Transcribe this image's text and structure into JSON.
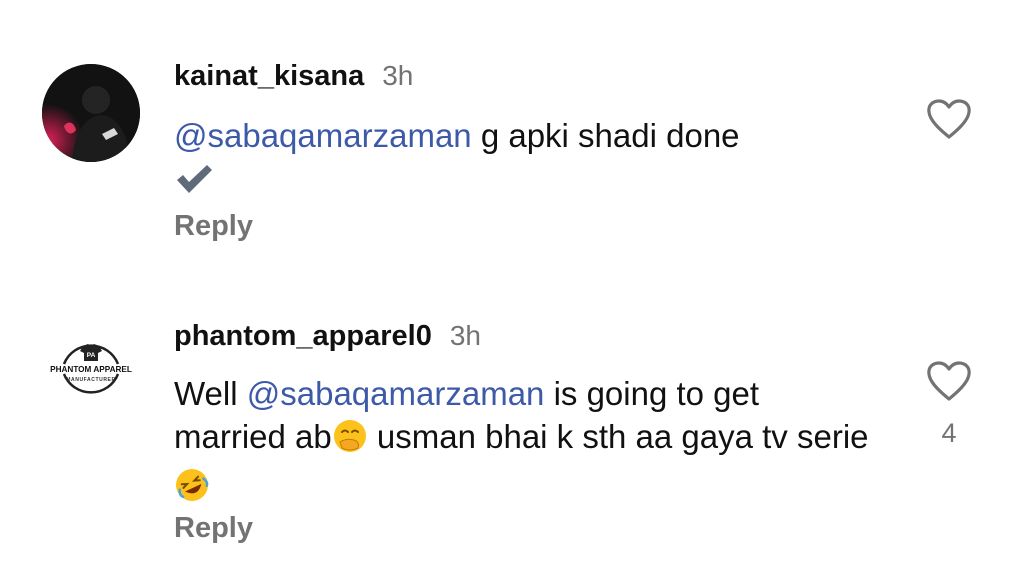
{
  "comments": [
    {
      "username": "kainat_kisana",
      "time": "3h",
      "mention": "@sabaqamarzaman",
      "text": " g apki shadi done",
      "check_icon": "heavy-check-mark-icon",
      "reply_label": "Reply",
      "likes": ""
    },
    {
      "username": "phantom_apparel0",
      "time": "3h",
      "text_prefix": "Well ",
      "mention": "@sabaqamarzaman",
      "text_mid": "  is going to get married ab",
      "text_mid2": " usman bhai k sth aa gaya tv serie",
      "reply_label": "Reply",
      "likes": "4",
      "avatar_brand": "PHANTOM APPAREL",
      "avatar_sub": "MANUFACTURER",
      "avatar_monogram": "PA"
    }
  ],
  "colors": {
    "mention": "#3d5aa8",
    "secondary_text": "#737373"
  }
}
